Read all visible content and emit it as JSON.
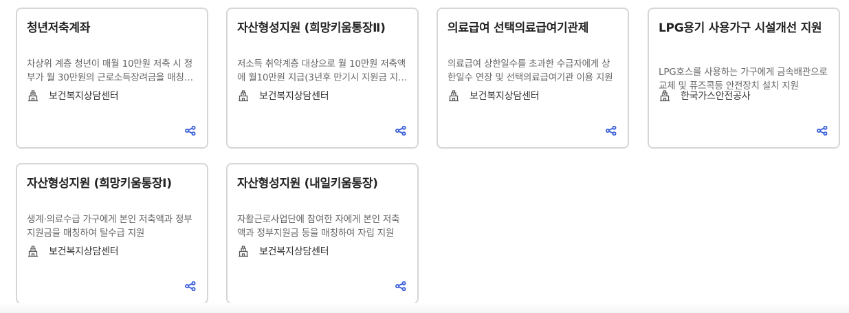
{
  "cards": [
    {
      "title": "청년저축계좌",
      "description": "차상위 계층 청년이 매월 10만원 저축 시 정부가 월 30만원의 근로소득장려금을 매칭하여 지원",
      "organization": "보건복지상담센터",
      "icons": {
        "org": "building-icon",
        "share": "share-icon"
      }
    },
    {
      "title": "자산형성지원 (희망키움통장Ⅱ)",
      "description": "저소득 취약계층 대상으로 월 10만원 저축액에 월10만원 지급(3년후 만기시 지원금 지급)",
      "organization": "보건복지상담센터",
      "icons": {
        "org": "building-icon",
        "share": "share-icon"
      }
    },
    {
      "title": "의료급여 선택의료급여기관제",
      "description": "의료급여 상한일수를 초과한 수급자에게 상한일수 연장 및 선택의료급여기관 이용 지원",
      "organization": "보건복지상담센터",
      "icons": {
        "org": "building-icon",
        "share": "share-icon"
      }
    },
    {
      "title": "LPG용기 사용가구 시설개선 지원",
      "description": "LPG호스를 사용하는 가구에게 금속배관으로 교체 및 퓨즈콕등 안전장치 설치 지원",
      "organization": "한국가스안전공사",
      "icons": {
        "org": "building-icon",
        "share": "share-icon"
      }
    },
    {
      "title": "자산형성지원 (희망키움통장Ⅰ)",
      "description": "생계·의료수급 가구에게 본인 저축액과 정부지원금을 매칭하여 탈수급 지원",
      "organization": "보건복지상담센터",
      "icons": {
        "org": "building-icon",
        "share": "share-icon"
      }
    },
    {
      "title": "자산형성지원 (내일키움통장)",
      "description": "자활근로사업단에 참여한 자에게 본인 저축액과 정부지원금 등을 매칭하여 자립 지원",
      "organization": "보건복지상담센터",
      "icons": {
        "org": "building-icon",
        "share": "share-icon"
      }
    }
  ],
  "colors": {
    "border": "#d6d6d6",
    "title": "#222222",
    "description": "#666666",
    "organization": "#333333",
    "share_icon": "#3a5fd9",
    "org_icon": "#555555"
  }
}
